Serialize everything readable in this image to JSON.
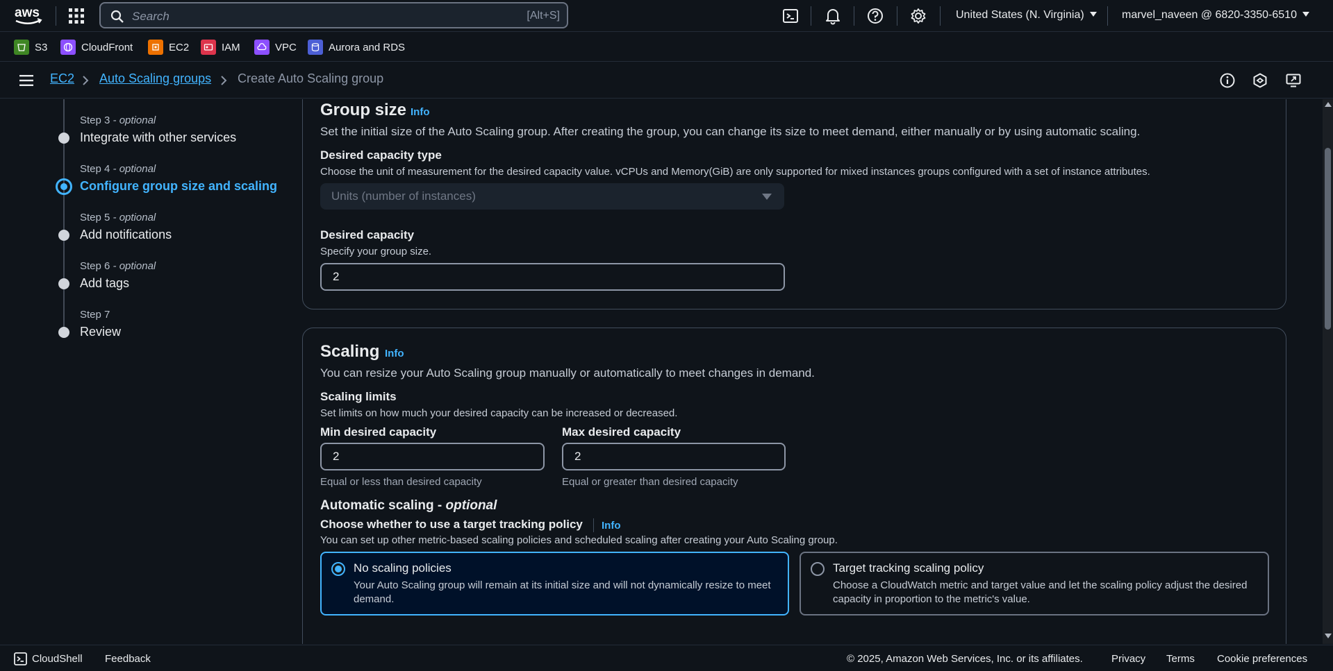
{
  "topbar": {
    "search_placeholder": "Search",
    "search_shortcut": "[Alt+S]",
    "region": "United States (N. Virginia)",
    "account": "marvel_naveen @ 6820-3350-6510"
  },
  "favorites": [
    {
      "label": "S3",
      "color": "#3f8624"
    },
    {
      "label": "CloudFront",
      "color": "#8c4fff"
    },
    {
      "label": "EC2",
      "color": "#ed7100"
    },
    {
      "label": "IAM",
      "color": "#dd344c"
    },
    {
      "label": "VPC",
      "color": "#8c4fff"
    },
    {
      "label": "Aurora and RDS",
      "color": "#4c5fd5"
    }
  ],
  "breadcrumb": {
    "ec2": "EC2",
    "asg": "Auto Scaling groups",
    "current": "Create Auto Scaling group"
  },
  "steps": [
    {
      "label": "Step 3",
      "optional": " - optional",
      "title": "Integrate with other services"
    },
    {
      "label": "Step 4",
      "optional": " - optional",
      "title": "Configure group size and scaling"
    },
    {
      "label": "Step 5",
      "optional": " - optional",
      "title": "Add notifications"
    },
    {
      "label": "Step 6",
      "optional": " - optional",
      "title": "Add tags"
    },
    {
      "label": "Step 7",
      "optional": "",
      "title": "Review"
    }
  ],
  "group_size": {
    "title": "Group size",
    "info": "Info",
    "description": "Set the initial size of the Auto Scaling group. After creating the group, you can change its size to meet demand, either manually or by using automatic scaling.",
    "capacity_type_label": "Desired capacity type",
    "capacity_type_desc": "Choose the unit of measurement for the desired capacity value. vCPUs and Memory(GiB) are only supported for mixed instances groups configured with a set of instance attributes.",
    "capacity_type_value": "Units (number of instances)",
    "desired_label": "Desired capacity",
    "desired_desc": "Specify your group size.",
    "desired_value": "2"
  },
  "scaling": {
    "title": "Scaling",
    "info": "Info",
    "description": "You can resize your Auto Scaling group manually or automatically to meet changes in demand.",
    "limits_label": "Scaling limits",
    "limits_desc": "Set limits on how much your desired capacity can be increased or decreased.",
    "min_label": "Min desired capacity",
    "min_value": "2",
    "min_hint": "Equal or less than desired capacity",
    "max_label": "Max desired capacity",
    "max_value": "2",
    "max_hint": "Equal or greater than desired capacity",
    "auto_title": "Automatic scaling - ",
    "auto_optional": "optional",
    "policy_label": "Choose whether to use a target tracking policy",
    "policy_info": "Info",
    "policy_desc": "You can set up other metric-based scaling policies and scheduled scaling after creating your Auto Scaling group.",
    "option_none_title": "No scaling policies",
    "option_none_desc": "Your Auto Scaling group will remain at its initial size and will not dynamically resize to meet demand.",
    "option_target_title": "Target tracking scaling policy",
    "option_target_desc": "Choose a CloudWatch metric and target value and let the scaling policy adjust the desired capacity in proportion to the metric's value."
  },
  "footer": {
    "cloudshell": "CloudShell",
    "feedback": "Feedback",
    "copyright": "© 2025, Amazon Web Services, Inc. or its affiliates.",
    "privacy": "Privacy",
    "terms": "Terms",
    "cookies": "Cookie preferences"
  },
  "colors": {
    "accent": "#42b4ff",
    "background": "#0f141a"
  }
}
